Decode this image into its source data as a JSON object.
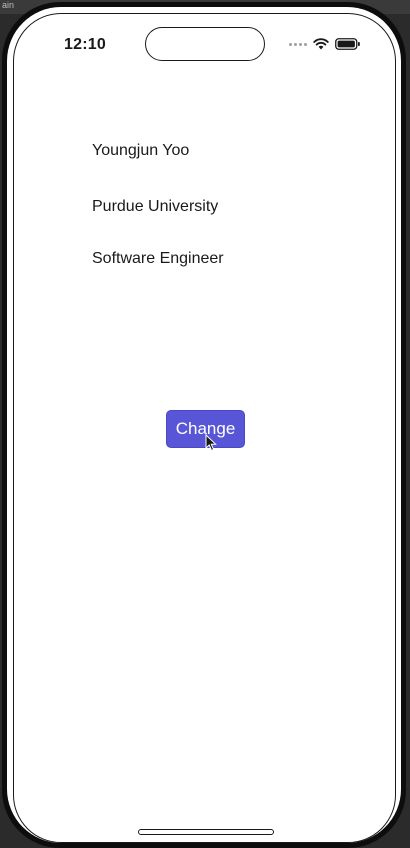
{
  "window": {
    "top_strip_text": "ain"
  },
  "status_bar": {
    "time": "12:10",
    "icons": [
      "signal-dots-icon",
      "wifi-icon",
      "battery-icon"
    ]
  },
  "profile": {
    "name": "Youngjun Yoo",
    "school": "Purdue University",
    "title": "Software Engineer"
  },
  "actions": {
    "change_label": "Change"
  },
  "colors": {
    "button_bg": "#5856d6",
    "button_text": "#ffffff",
    "text": "#1a1a1a",
    "background": "#ffffff"
  }
}
